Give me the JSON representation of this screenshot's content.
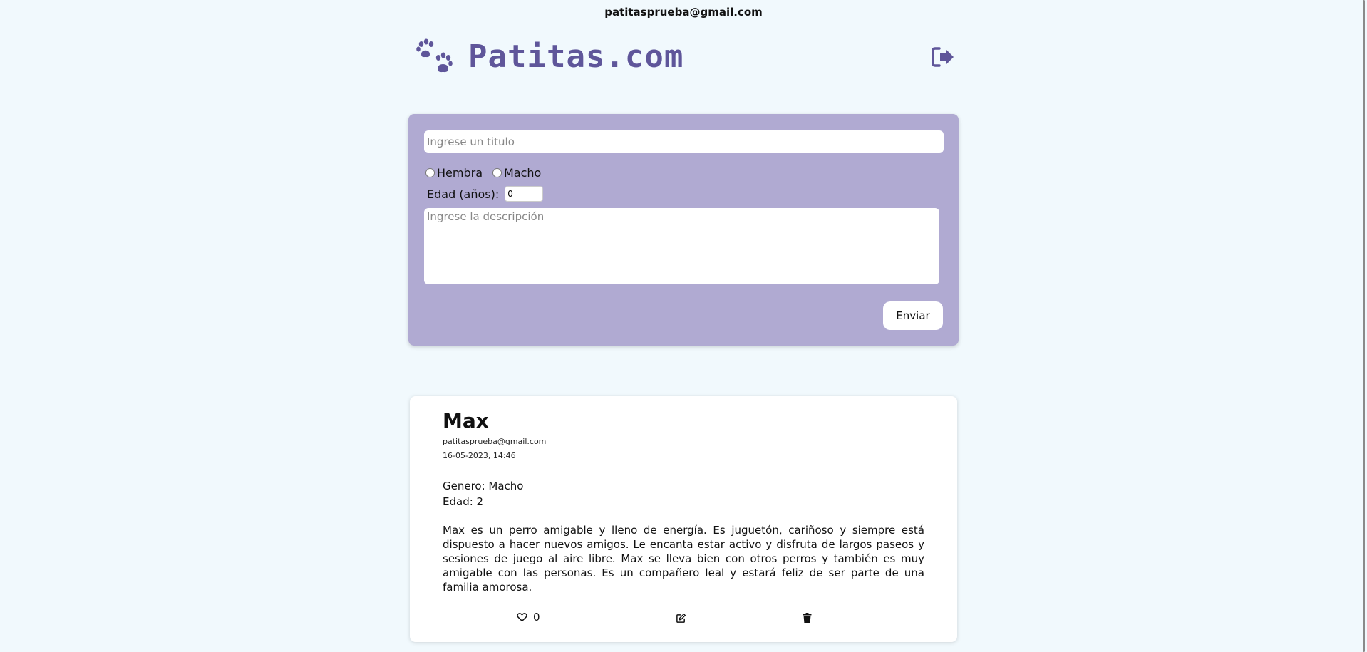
{
  "header": {
    "user_email": "patitasprueba@gmail.com",
    "brand_name": "Patitas.com",
    "logo_icon": "paw-prints-icon",
    "logout_icon": "sign-out-icon"
  },
  "form": {
    "title_placeholder": "Ingrese un titulo",
    "gender_options": [
      "Hembra",
      "Macho"
    ],
    "age_label": "Edad (años):",
    "age_value": "0",
    "description_placeholder": "Ingrese la descripción",
    "submit_label": "Enviar"
  },
  "posts": [
    {
      "title": "Max",
      "author": "patitasprueba@gmail.com",
      "date": "16-05-2023, 14:46",
      "gender": "Genero: Macho",
      "age": "Edad: 2",
      "description": "Max es un perro amigable y lleno de energía. Es juguetón, cariñoso y siempre está dispuesto a hacer nuevos amigos. Le encanta estar activo y disfruta de largos paseos y sesiones de juego al aire libre. Max se lleva bien con otros perros y también es muy amigable con las personas. Es un compañero leal y estará feliz de ser parte de una familia amorosa.",
      "likes": "0",
      "icons": {
        "like": "heart-outline-icon",
        "edit": "edit-icon",
        "delete": "trash-icon"
      }
    }
  ],
  "colors": {
    "background": "#f1f9fd",
    "brand": "#5f569a",
    "form_panel": "#b0aad2"
  }
}
